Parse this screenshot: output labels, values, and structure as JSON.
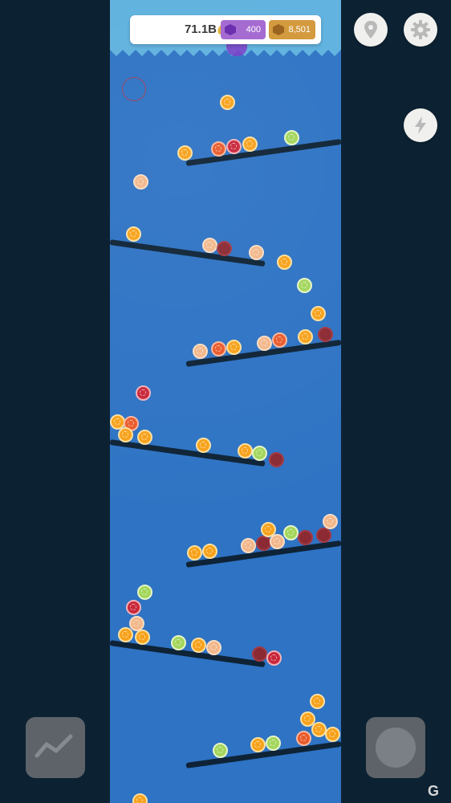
{
  "hud": {
    "money": "71.1B",
    "gems": "400",
    "gold": "8,501"
  },
  "icons": {
    "map_button": "map-pin-icon",
    "settings_button": "gear-icon",
    "boost_button": "lightning-icon",
    "stats_button": "line-chart-icon",
    "action_button": "circle-icon",
    "money": "coin-icon",
    "gems": "gem-icon",
    "gold": "gold-icon"
  },
  "colors": {
    "background": "#0c2233",
    "play_area": "#2e73c4",
    "ramp": "#0e2336",
    "gem_badge": "#a66bd1",
    "gold_badge": "#d39a3e"
  },
  "fruit_types": [
    "orange",
    "peach",
    "grapefruit",
    "lime",
    "red",
    "plum"
  ]
}
